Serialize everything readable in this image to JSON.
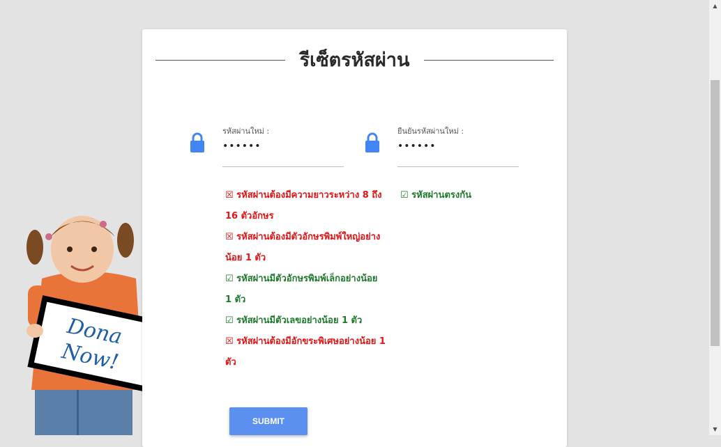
{
  "page": {
    "title": "รีเซ็ตรหัสผ่าน",
    "accent_color": "#4285f4",
    "fail_color": "#e01515",
    "pass_color": "#1f7a2c"
  },
  "form": {
    "new_password": {
      "label": "รหัสผ่านใหม่ :",
      "value": "••••••",
      "icon": "lock-icon"
    },
    "confirm_password": {
      "label": "ยืนยันรหัสผ่านใหม่ :",
      "value": "••••••",
      "icon": "lock-icon"
    },
    "rules": [
      {
        "text": "☒ รหัสผ่านต้องมีความยาวระหว่าง 8 ถึง 16 ตัวอักษร",
        "status": "fail"
      },
      {
        "text": "☒ รหัสผ่านต้องมีตัวอักษรพิมพ์ใหญ่อย่างน้อย 1 ตัว",
        "status": "fail"
      },
      {
        "text": "☑ รหัสผ่านมีตัวอักษรพิมพ์เล็กอย่างน้อย 1 ตัว",
        "status": "pass"
      },
      {
        "text": "☑ รหัสผ่านมีตัวเลขอย่างน้อย 1 ตัว",
        "status": "pass"
      },
      {
        "text": "☒ รหัสผ่านต้องมีอักขระพิเศษอย่างน้อย 1 ตัว",
        "status": "fail"
      }
    ],
    "match_rule": {
      "text": "☑ รหัสผ่านตรงกัน",
      "status": "pass"
    },
    "submit_label": "SUBMIT"
  },
  "illustration": {
    "sign_text": "Donate Now!"
  }
}
